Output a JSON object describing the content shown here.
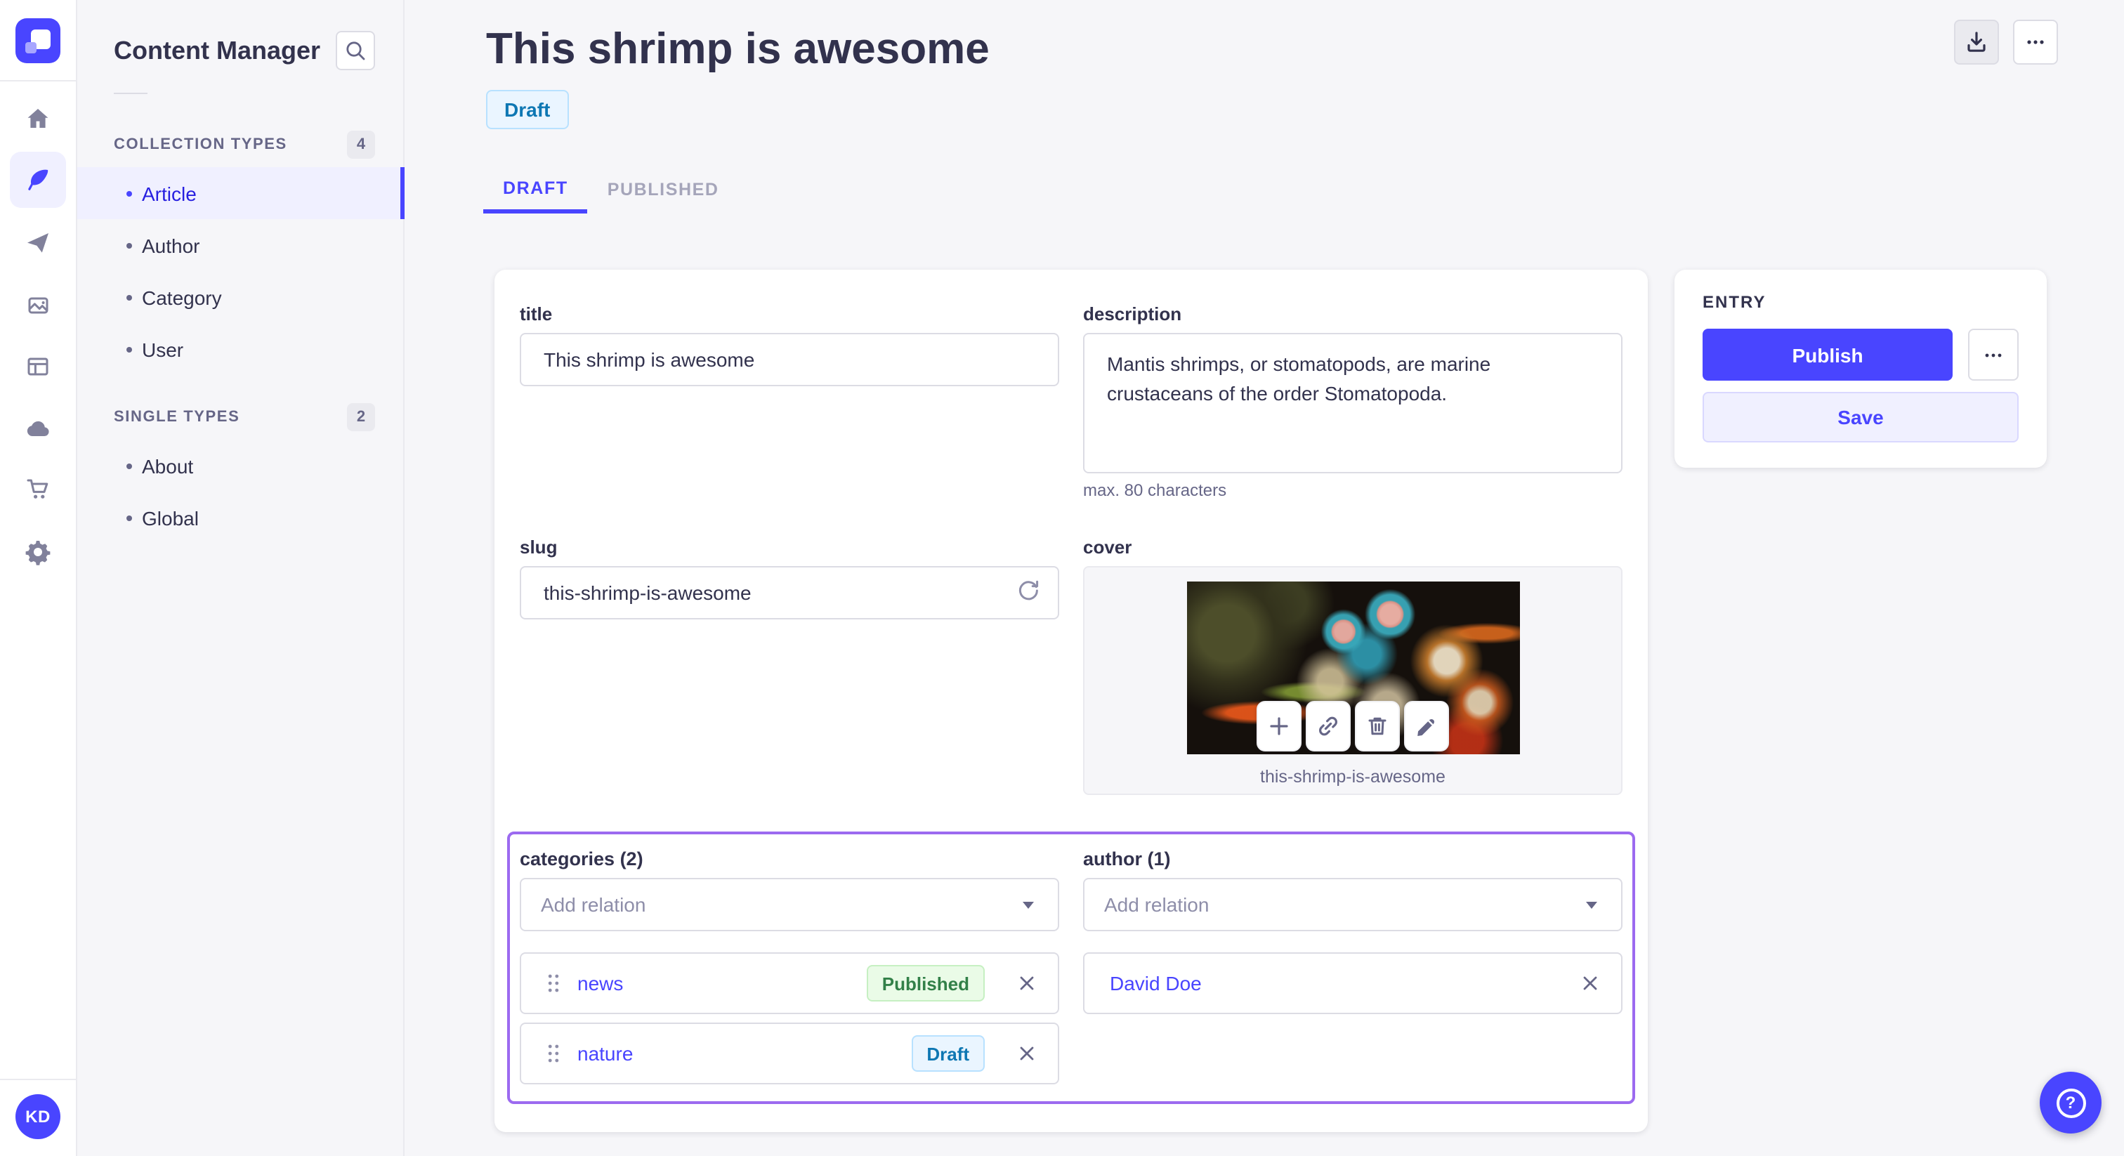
{
  "colors": {
    "primary": "#4945ff",
    "active_nav_text": "#271fe0",
    "active_nav_bg": "#f0f0ff",
    "highlight_border": "#9c6af0",
    "draft_badge_text": "#0e77b3",
    "draft_badge_bg": "#eaf5ff",
    "published_badge_text": "#328048",
    "published_badge_bg": "#eafbe7",
    "page_bg": "#f6f6f9"
  },
  "rail": {
    "icons": [
      "strapi-logo",
      "home",
      "content-feather",
      "send",
      "media-images",
      "layout",
      "cloud",
      "cart",
      "settings-gear"
    ],
    "avatar": "KD"
  },
  "subnav": {
    "title": "Content Manager",
    "collection": {
      "label": "COLLECTION TYPES",
      "count": "4",
      "items": [
        {
          "label": "Article"
        },
        {
          "label": "Author"
        },
        {
          "label": "Category"
        },
        {
          "label": "User"
        }
      ]
    },
    "single": {
      "label": "SINGLE TYPES",
      "count": "2",
      "items": [
        {
          "label": "About"
        },
        {
          "label": "Global"
        }
      ]
    }
  },
  "header": {
    "title": "This shrimp is awesome",
    "status": "Draft",
    "tabs": {
      "draft": "DRAFT",
      "published": "PUBLISHED"
    }
  },
  "form": {
    "title": {
      "label": "title",
      "value": "This shrimp is awesome"
    },
    "description": {
      "label": "description",
      "value": "Mantis shrimps, or stomatopods, are marine crustaceans of the order Stomatopoda.",
      "hint": "max. 80 characters"
    },
    "slug": {
      "label": "slug",
      "value": "this-shrimp-is-awesome"
    },
    "cover": {
      "label": "cover",
      "caption": "this-shrimp-is-awesome"
    },
    "categories": {
      "label": "categories (2)",
      "placeholder": "Add relation",
      "items": [
        {
          "name": "news",
          "badge": "Published"
        },
        {
          "name": "nature",
          "badge": "Draft"
        }
      ]
    },
    "author": {
      "label": "author (1)",
      "placeholder": "Add relation",
      "items": [
        {
          "name": "David Doe"
        }
      ]
    }
  },
  "entry": {
    "label": "ENTRY",
    "publish": "Publish",
    "save": "Save"
  }
}
